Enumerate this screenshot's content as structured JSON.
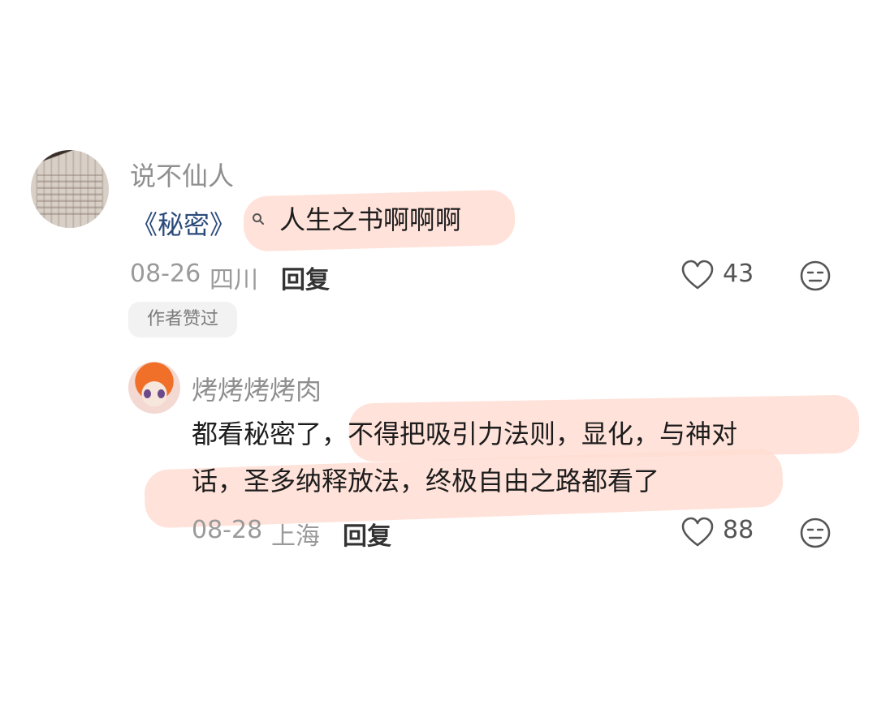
{
  "comments": [
    {
      "username": "说不仙人",
      "link_text": "《秘密》",
      "search_icon": "search-icon",
      "text": "人生之书啊啊啊",
      "date": "08-26",
      "location": "四川",
      "reply_label": "回复",
      "likes": "43",
      "author_badge": "作者赞过"
    },
    {
      "username": "烤烤烤烤肉",
      "text_line1": "都看秘密了，不得把吸引力法则，显化，与神对",
      "text_line2": "话，圣多纳释放法，终极自由之路都看了",
      "date": "08-28",
      "location": "上海",
      "reply_label": "回复",
      "likes": "88"
    }
  ],
  "icons": {
    "like": "heart-icon",
    "dislike": "neutral-face-icon",
    "search": "search-icon"
  },
  "colors": {
    "highlight": "#ffddd2",
    "link": "#2b4a7a"
  }
}
